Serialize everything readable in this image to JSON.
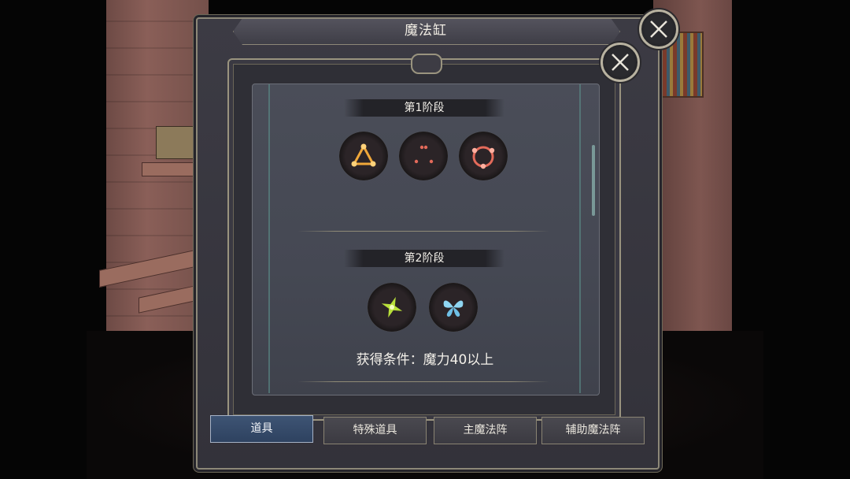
{
  "window": {
    "title": "魔法缸"
  },
  "stages": [
    {
      "header": "第1阶段",
      "icons": [
        "triangle-circuit-icon",
        "dots-circle-icon",
        "ring-nodes-icon"
      ]
    },
    {
      "header": "第2阶段",
      "icons": [
        "green-star-icon",
        "blue-butterfly-icon"
      ],
      "condition": "获得条件：魔力40以上"
    }
  ],
  "tabs": [
    {
      "label": "道具",
      "active": true
    },
    {
      "label": "特殊道具",
      "active": false
    },
    {
      "label": "主魔法阵",
      "active": false
    },
    {
      "label": "辅助魔法阵",
      "active": false
    }
  ],
  "colors": {
    "panel": "#33323a",
    "content": "#4a4d58",
    "active_tab": "#2e4260",
    "border_gold": "#9a947f",
    "rune_orange": "#f0a83a",
    "rune_red": "#e36a5a",
    "rune_green": "#b8e03a",
    "rune_blue": "#8fd6f2"
  }
}
